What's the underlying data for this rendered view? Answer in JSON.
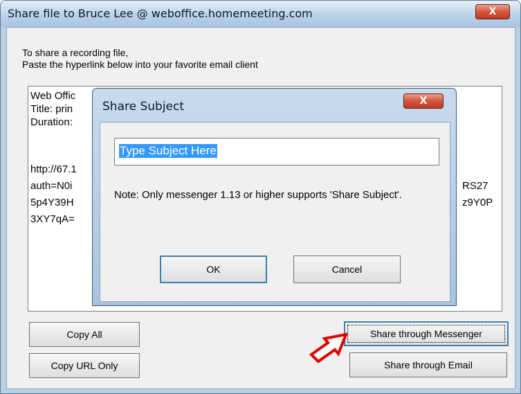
{
  "window": {
    "title": "Share file to Bruce Lee @ weboffice.homemeeting.com",
    "close_label": "X"
  },
  "instructions": {
    "line1": "To share a recording file,",
    "line2": "Paste the hyperlink below into your favorite email client"
  },
  "textarea": {
    "lines_left": [
      "Web Offic",
      "Title: prin",
      "Duration:",
      "",
      "http://67.1",
      "auth=N0i",
      "5p4Y39H",
      "3XY7qA="
    ],
    "lines_right": [
      "RS27",
      "z9Y0P"
    ]
  },
  "buttons": {
    "copy_all": "Copy All",
    "copy_url_only": "Copy URL Only",
    "share_messenger": "Share through Messenger",
    "share_email": "Share through Email"
  },
  "dialog": {
    "title": "Share Subject",
    "close_label": "X",
    "subject_value": "Type Subject Here",
    "note": "Note: Only messenger 1.13 or higher supports 'Share Subject'.",
    "ok": "OK",
    "cancel": "Cancel"
  },
  "annotation": {
    "arrow_color": "#e00000"
  }
}
